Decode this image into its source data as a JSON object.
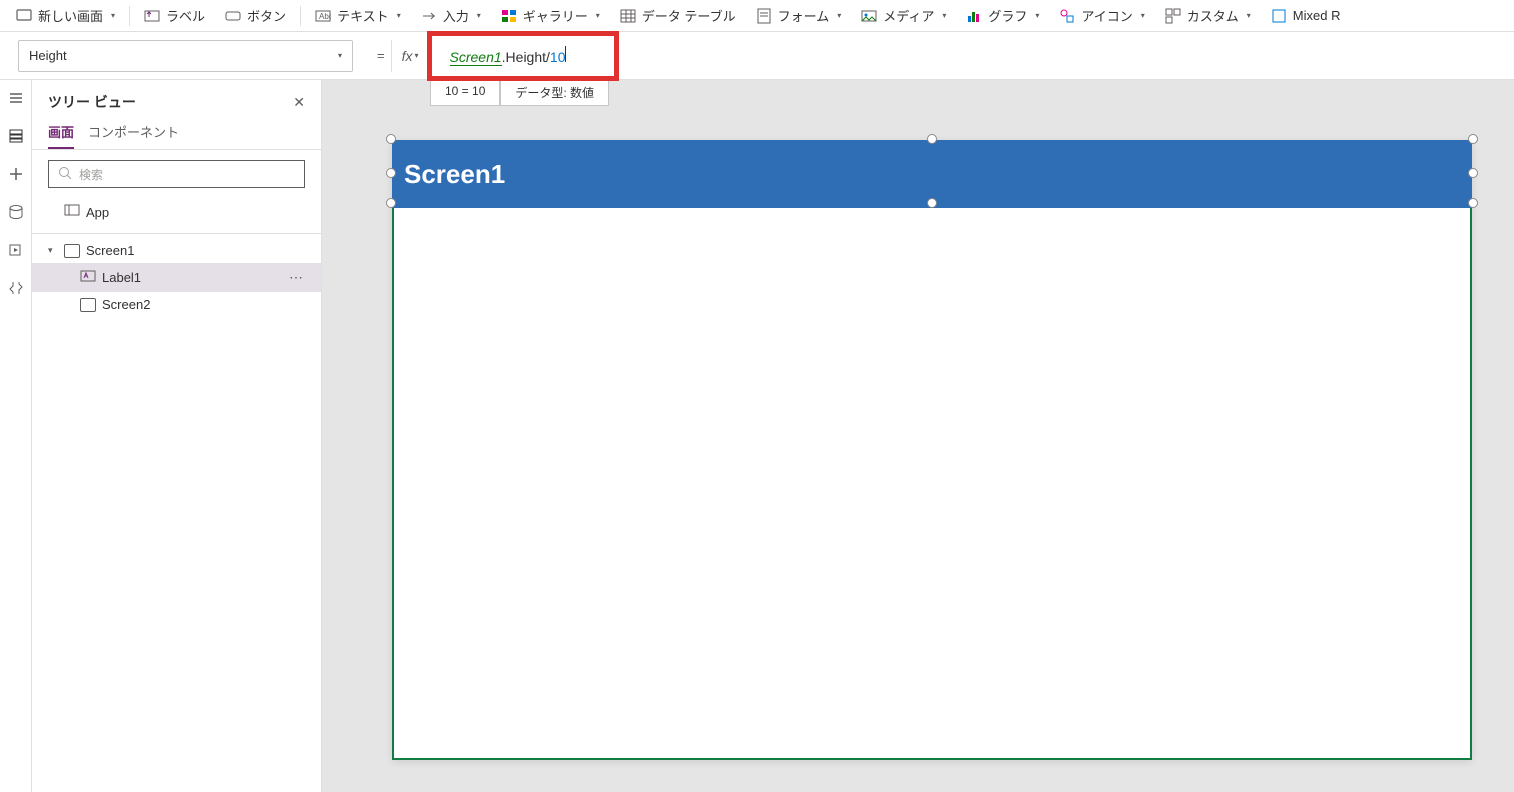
{
  "toolbar": {
    "newScreen": "新しい画面",
    "label": "ラベル",
    "button": "ボタン",
    "text": "テキスト",
    "input": "入力",
    "gallery": "ギャラリー",
    "dataTable": "データ テーブル",
    "form": "フォーム",
    "media": "メディア",
    "chart": "グラフ",
    "icon": "アイコン",
    "custom": "カスタム",
    "mixed": "Mixed R"
  },
  "formula": {
    "property": "Height",
    "equals": "=",
    "fx": "fx",
    "ident": "Screen1",
    "rest_prop": ".Height/",
    "num": "10",
    "hint_eval": "10  =  10",
    "hint_type": "データ型: 数値"
  },
  "tree": {
    "title": "ツリー ビュー",
    "tab_screen": "画面",
    "tab_component": "コンポーネント",
    "search_placeholder": "検索",
    "app_node": "App",
    "screen1": "Screen1",
    "label1": "Label1",
    "screen2": "Screen2"
  },
  "canvas": {
    "label_text": "Screen1"
  }
}
